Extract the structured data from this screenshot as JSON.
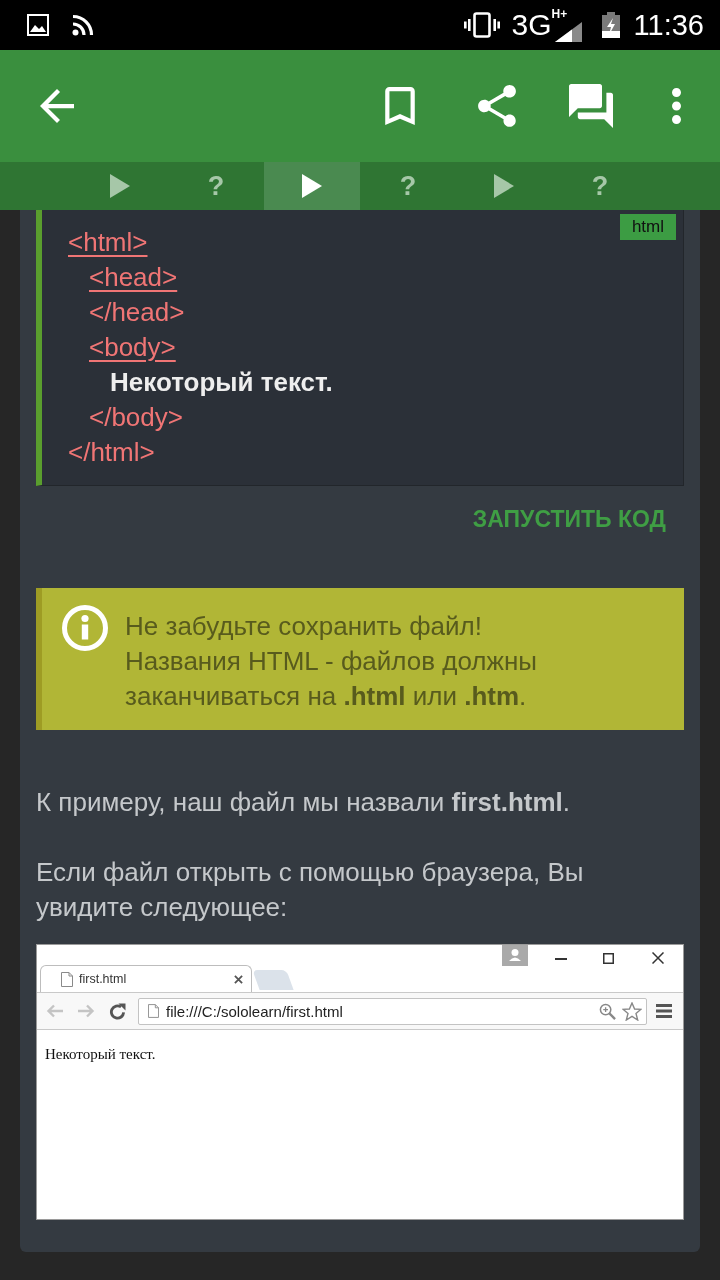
{
  "status_bar": {
    "network": "3G",
    "network_badge": "H+",
    "time": "11:36"
  },
  "lesson_tabs": [
    {
      "kind": "lesson",
      "selected": false
    },
    {
      "kind": "quiz",
      "label": "?",
      "selected": false
    },
    {
      "kind": "lesson",
      "selected": true
    },
    {
      "kind": "quiz",
      "label": "?",
      "selected": false
    },
    {
      "kind": "lesson",
      "selected": false
    },
    {
      "kind": "quiz",
      "label": "?",
      "selected": false
    }
  ],
  "code_block": {
    "language": "html",
    "lines": [
      {
        "kind": "tag",
        "text": "<html>",
        "underlined": true,
        "children": [
          {
            "kind": "tag",
            "text": "<head>",
            "underlined": true
          },
          {
            "kind": "tag",
            "text": "</head>",
            "underlined": false
          },
          {
            "kind": "tag",
            "text": "<body>",
            "underlined": true,
            "children": [
              {
                "kind": "text",
                "text": "Некоторый текст."
              }
            ]
          },
          {
            "kind": "tag",
            "text": "</body>",
            "underlined": false
          }
        ]
      },
      {
        "kind": "tag",
        "text": "</html>",
        "underlined": false
      }
    ]
  },
  "run_button": "ЗАПУСТИТЬ КОД",
  "note": {
    "paragraphs": [
      "Не забудьте сохранить файл!",
      "Названия HTML - файлов должны заканчиваться на **.html** или **.htm**."
    ]
  },
  "body_text": [
    "К примеру, наш файл мы назвали **first.html**.",
    "Если файл открыть с помощью браузера, Вы увидите следующее:"
  ],
  "browser_screenshot": {
    "tab_title": "first.html",
    "url": "file:///C:/sololearn/first.html",
    "page_text": "Некоторый текст."
  }
}
